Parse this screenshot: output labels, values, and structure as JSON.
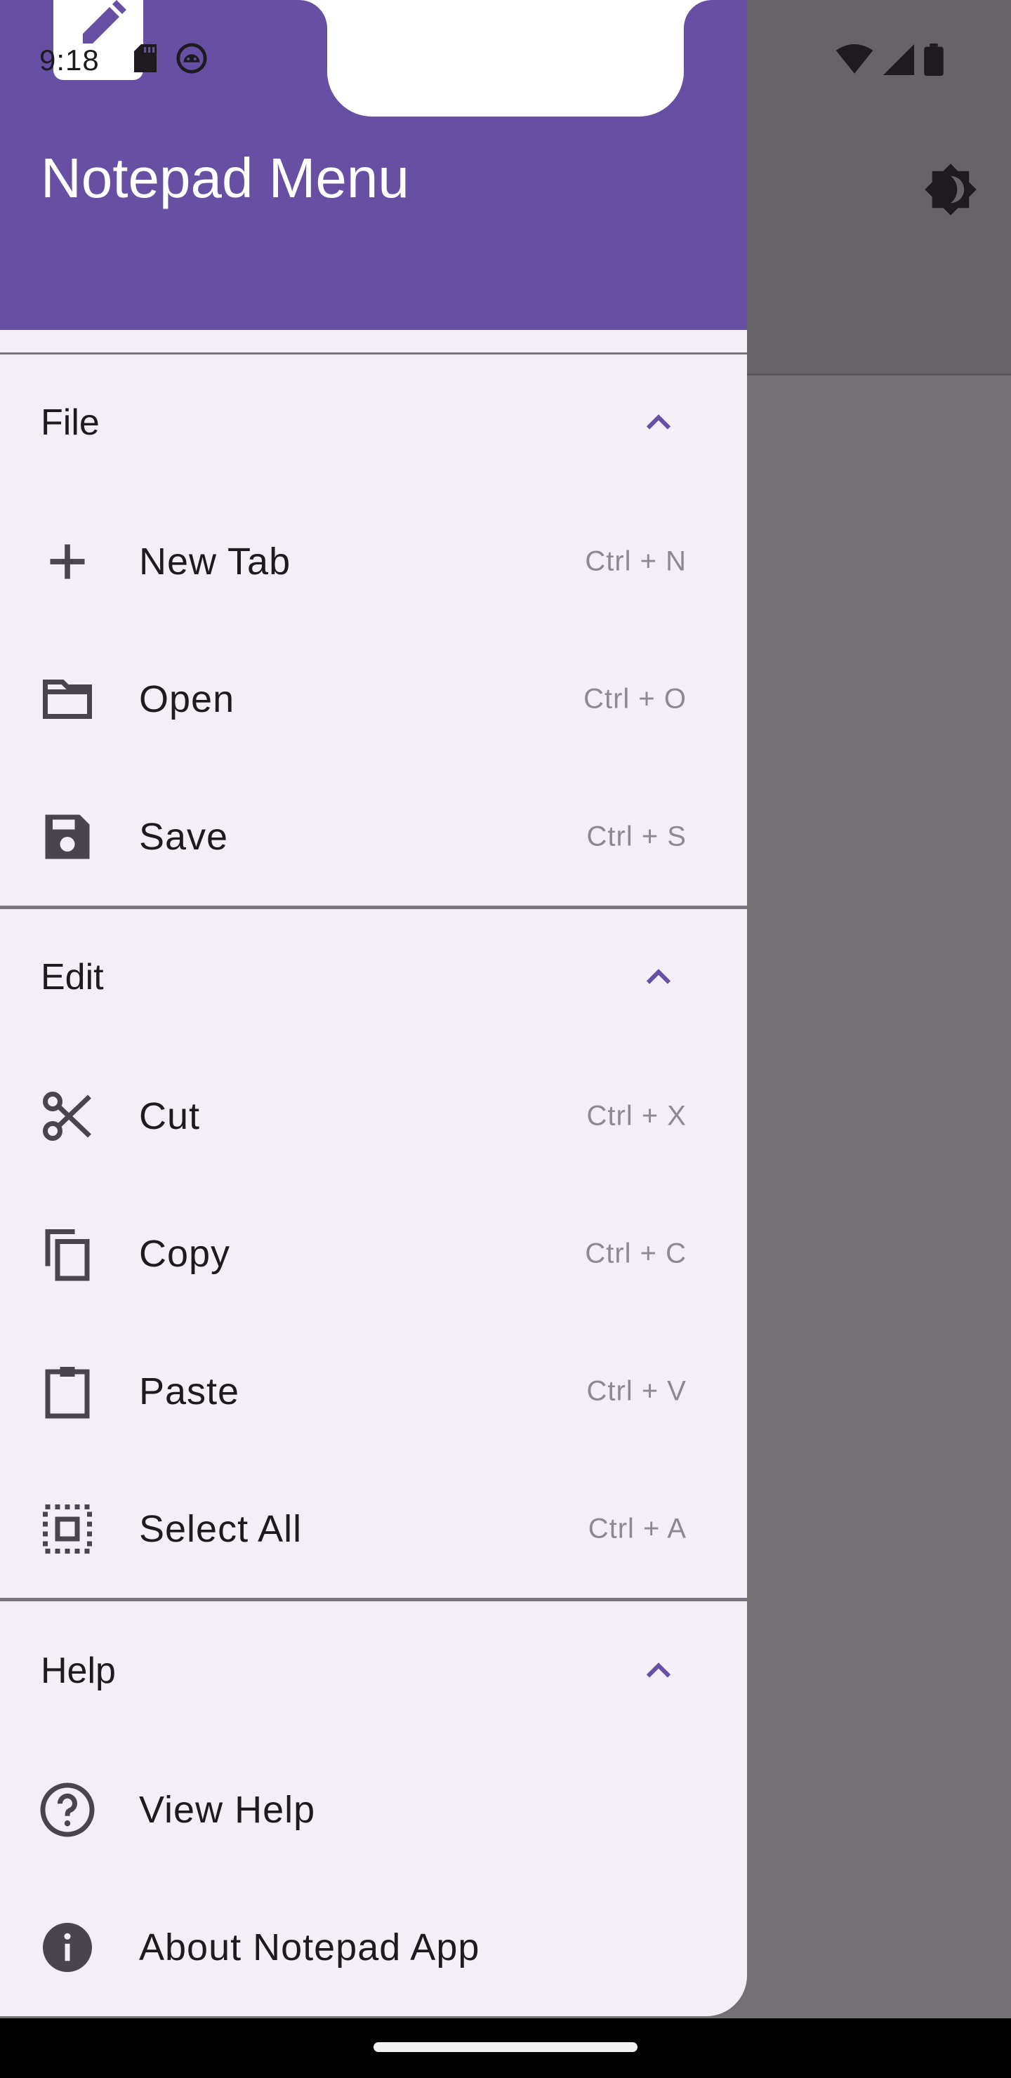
{
  "status_bar": {
    "time": "9:18",
    "left_icons": [
      "sd-card-icon",
      "android-debug-icon"
    ],
    "right_icons": [
      "wifi-icon",
      "cell-signal-icon",
      "battery-icon"
    ]
  },
  "app": {
    "action_icon": "brightness-icon"
  },
  "drawer": {
    "title": "Notepad Menu",
    "header_color": "#6750a4",
    "background_color": "#f4eff6",
    "sections": [
      {
        "label": "File",
        "expanded": true,
        "items": [
          {
            "label": "New Tab",
            "shortcut": "Ctrl + N",
            "icon": "plus-icon"
          },
          {
            "label": "Open",
            "shortcut": "Ctrl + O",
            "icon": "folder-icon"
          },
          {
            "label": "Save",
            "shortcut": "Ctrl + S",
            "icon": "save-icon"
          }
        ]
      },
      {
        "label": "Edit",
        "expanded": true,
        "items": [
          {
            "label": "Cut",
            "shortcut": "Ctrl + X",
            "icon": "scissors-icon"
          },
          {
            "label": "Copy",
            "shortcut": "Ctrl + C",
            "icon": "copy-icon"
          },
          {
            "label": "Paste",
            "shortcut": "Ctrl + V",
            "icon": "clipboard-icon"
          },
          {
            "label": "Select All",
            "shortcut": "Ctrl + A",
            "icon": "select-all-icon"
          }
        ]
      },
      {
        "label": "Help",
        "expanded": true,
        "items": [
          {
            "label": "View Help",
            "icon": "help-circle-icon"
          },
          {
            "label": "About Notepad App",
            "icon": "info-icon"
          }
        ]
      }
    ]
  }
}
